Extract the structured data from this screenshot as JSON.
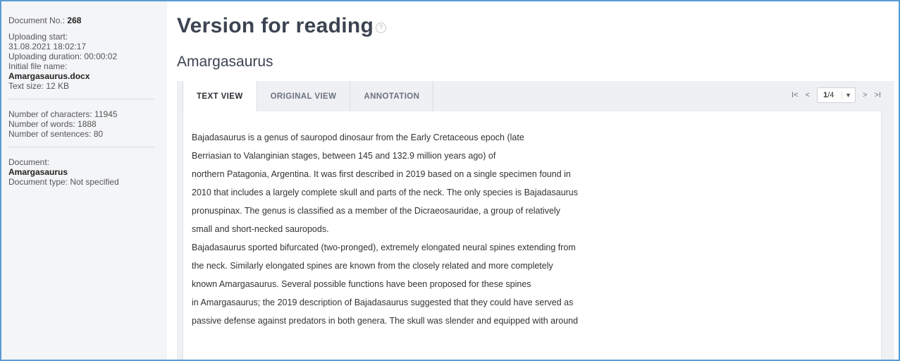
{
  "sidebar": {
    "doc_no_label": "Document No.:",
    "doc_no": "268",
    "upload_start_label": "Uploading start:",
    "upload_start": "31.08.2021 18:02:17",
    "upload_duration": "Uploading duration: 00:00:02",
    "initial_file_label": "Initial file name:",
    "initial_file": "Amargasaurus.docx",
    "text_size": "Text size: 12 KB",
    "characters": "Number of characters: 11945",
    "words": "Number of words: 1888",
    "sentences": "Number of sentences: 80",
    "document_label": "Document:",
    "document_name": "Amargasaurus",
    "document_type": "Document type: Not specified"
  },
  "main": {
    "title": "Version for reading",
    "help_icon": "?",
    "subtitle": "Amargasaurus"
  },
  "tabs": [
    {
      "label": "TEXT VIEW"
    },
    {
      "label": "ORIGINAL VIEW"
    },
    {
      "label": "ANNOTATION"
    }
  ],
  "pager": {
    "first": "I<",
    "prev": "<",
    "current": "1",
    "total": "/4",
    "next": ">",
    "last": ">I"
  },
  "text_lines": [
    "Bajadasaurus is a genus of sauropod dinosaur from the Early Cretaceous epoch (late",
    "Berriasian to Valanginian stages, between 145 and 132.9 million years ago) of",
    "northern Patagonia, Argentina. It was first described in 2019 based on a single specimen found in",
    "2010 that includes a largely complete skull and parts of the neck. The only species is Bajadasaurus",
    "pronuspinax. The genus is classified as a member of the Dicraeosauridae, a group of relatively",
    "small and short-necked sauropods.",
    "Bajadasaurus sported bifurcated (two-pronged), extremely elongated neural spines extending from",
    "the neck. Similarly elongated spines are known from the closely related and more completely",
    "known Amargasaurus. Several possible functions have been proposed for these spines",
    "in Amargasaurus; the 2019 description of Bajadasaurus suggested that they could have served as",
    "passive defense against predators in both genera. The skull was slender and equipped with around"
  ]
}
